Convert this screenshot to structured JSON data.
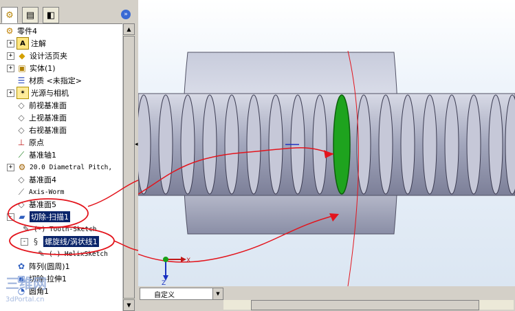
{
  "tree": {
    "root": "零件4",
    "items": [
      {
        "label": "注解",
        "icon": "annotation-icon",
        "pm": "+"
      },
      {
        "label": "设计活页夹",
        "icon": "design-binder-icon",
        "pm": "+"
      },
      {
        "label": "实体(1)",
        "icon": "solid-bodies-icon",
        "pm": "+"
      },
      {
        "label": "材质 <未指定>",
        "icon": "material-icon",
        "pm": ""
      },
      {
        "label": "光源与相机",
        "icon": "lights-cameras-icon",
        "pm": "+"
      },
      {
        "label": "前视基准面",
        "icon": "plane-icon",
        "pm": ""
      },
      {
        "label": "上视基准面",
        "icon": "plane-icon",
        "pm": ""
      },
      {
        "label": "右视基准面",
        "icon": "plane-icon",
        "pm": ""
      },
      {
        "label": "原点",
        "icon": "origin-icon",
        "pm": ""
      },
      {
        "label": "基准轴1",
        "icon": "axis-icon",
        "pm": ""
      },
      {
        "label": "20.0 Diametral Pitch,",
        "icon": "gear-feature-icon",
        "pm": "+"
      },
      {
        "label": "基准面4",
        "icon": "plane-icon",
        "pm": ""
      },
      {
        "label": "Axis-Worm",
        "icon": "axis-icon",
        "pm": ""
      },
      {
        "label": "基准面5",
        "icon": "plane-icon",
        "pm": ""
      },
      {
        "label": "切除-扫描1",
        "icon": "swept-cut-icon",
        "pm": "-"
      },
      {
        "label": "(-) Tooth-Sketch",
        "icon": "sketch-icon",
        "pm": ""
      },
      {
        "label": "螺旋线/涡状线1",
        "icon": "helix-icon",
        "pm": "-"
      },
      {
        "label": "(-) HelixSketch",
        "icon": "sketch-icon",
        "pm": ""
      },
      {
        "label": "阵列(圆周)1",
        "icon": "circular-pattern-icon",
        "pm": ""
      },
      {
        "label": "切除-拉伸1",
        "icon": "extruded-cut-icon",
        "pm": ""
      },
      {
        "label": "圆角1",
        "icon": "fillet-icon",
        "pm": ""
      }
    ]
  },
  "view": {
    "orientation_value": "自定义",
    "triad_x": "X",
    "triad_z": "Z"
  },
  "watermark": {
    "brand": "三维网",
    "url": "3dPortal.cn"
  },
  "colors": {
    "highlight": "#0a246a",
    "annotation": "#e3141c",
    "selected_face": "#1ea31e"
  }
}
